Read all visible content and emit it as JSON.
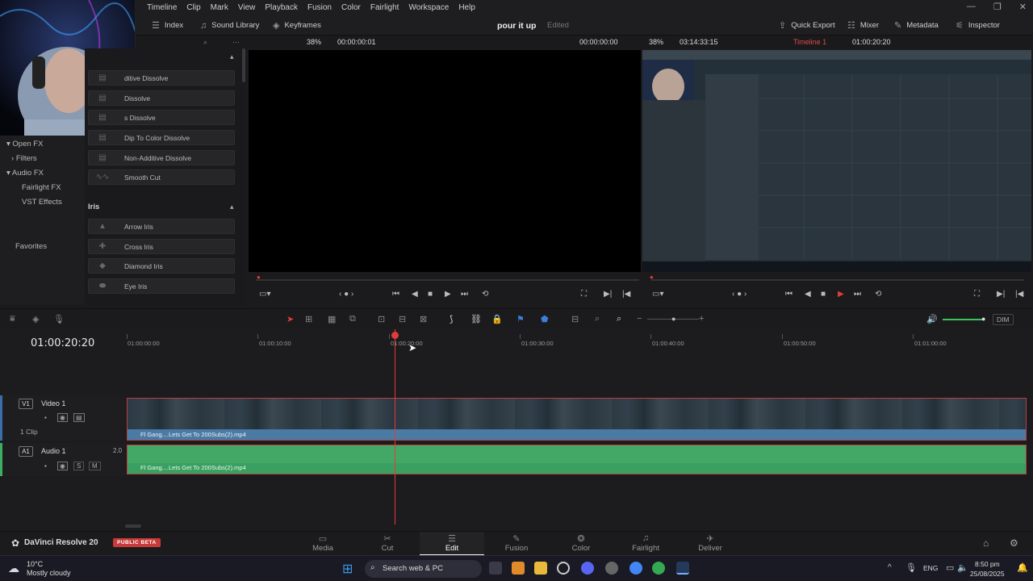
{
  "menu": [
    "Timeline",
    "Clip",
    "Mark",
    "View",
    "Playback",
    "Fusion",
    "Color",
    "Fairlight",
    "Workspace",
    "Help"
  ],
  "toolbar": {
    "index": "Index",
    "sound_library": "Sound Library",
    "keyframes": "Keyframes",
    "project_title": "pour it up",
    "project_status": "Edited",
    "quick_export": "Quick Export",
    "mixer": "Mixer",
    "metadata": "Metadata",
    "inspector": "Inspector"
  },
  "viewer_bar": {
    "src_zoom": "38%",
    "src_tc": "00:00:00:01",
    "src_tc2": "00:00:00:00",
    "rec_zoom": "38%",
    "rec_duration": "03:14:33:15",
    "timeline_name": "Timeline 1",
    "rec_tc": "01:00:20:20"
  },
  "left_panel": {
    "items": [
      "Open FX",
      "Filters",
      "Audio FX",
      "Fairlight FX",
      "VST Effects",
      "Favorites"
    ]
  },
  "fx_panel": {
    "dissolves": [
      "Additive Dissolve",
      "Blur Dissolve",
      "Cross Dissolve",
      "Dip To Color Dissolve",
      "Non-Additive Dissolve",
      "Smooth Cut"
    ],
    "dissolves_visible": [
      "ditive Dissolve",
      "Dissolve",
      "s Dissolve",
      "Dip To Color Dissolve",
      "Non-Additive Dissolve",
      "Smooth Cut"
    ],
    "iris_header": "Iris",
    "iris": [
      "Arrow Iris",
      "Cross Iris",
      "Diamond Iris",
      "Eye Iris"
    ]
  },
  "timeline": {
    "timecode": "01:00:20:20",
    "ruler": [
      "01:00:00:00",
      "01:00:10:00",
      "01:00:20:00",
      "01:00:30:00",
      "01:00:40:00",
      "01:00:50:00",
      "01:01:00:00"
    ],
    "video_track": {
      "badge": "V1",
      "name": "Video 1",
      "clips": "1 Clip"
    },
    "audio_track": {
      "badge": "A1",
      "name": "Audio 1",
      "channels": "2.0"
    },
    "video_clip_name": "Fl Gang....Lets Get To 200Subs(2).mp4",
    "audio_clip_name": "Fl Gang....Lets Get To 200Subs(2).mp4",
    "dim": "DIM"
  },
  "pages": [
    {
      "label": "Media",
      "icon": "media-icon",
      "active": false
    },
    {
      "label": "Cut",
      "icon": "cut-icon",
      "active": false
    },
    {
      "label": "Edit",
      "icon": "edit-icon",
      "active": true
    },
    {
      "label": "Fusion",
      "icon": "fusion-icon",
      "active": false
    },
    {
      "label": "Color",
      "icon": "color-icon",
      "active": false
    },
    {
      "label": "Fairlight",
      "icon": "fairlight-icon",
      "active": false
    },
    {
      "label": "Deliver",
      "icon": "deliver-icon",
      "active": false
    }
  ],
  "brand": {
    "name": "DaVinci Resolve 20",
    "badge": "PUBLIC BETA"
  },
  "taskbar": {
    "temp": "10°C",
    "weather": "Mostly cloudy",
    "search": "Search web & PC",
    "lang": "ENG",
    "time": "8:50 pm",
    "date": "25/08/2025"
  },
  "colors": {
    "accent_red": "#e23a3a",
    "video_clip": "#4a7ba5",
    "audio_clip": "#3aa061",
    "beta": "#c93a3a"
  }
}
